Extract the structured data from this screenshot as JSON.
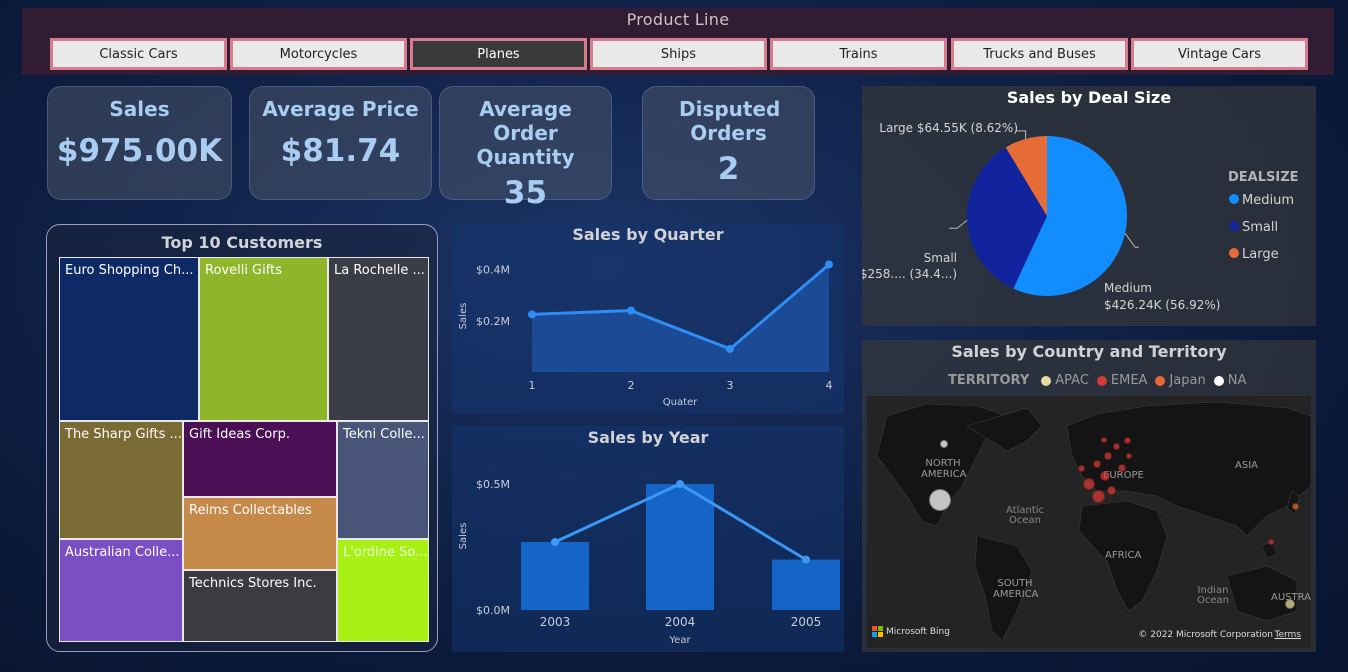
{
  "slicer": {
    "title": "Product Line",
    "items": [
      "Classic Cars",
      "Motorcycles",
      "Planes",
      "Ships",
      "Trains",
      "Trucks and Buses",
      "Vintage Cars"
    ],
    "selected": "Planes"
  },
  "kpis": {
    "sales": {
      "label": "Sales",
      "value": "$975.00K"
    },
    "avg_price": {
      "label": "Average Price",
      "value": "$81.74"
    },
    "avg_qty": {
      "label": "Average Order Quantity",
      "value": "35"
    },
    "disputed": {
      "label": "Disputed Orders",
      "value": "2"
    }
  },
  "top_customers": {
    "title": "Top 10 Customers",
    "items": [
      {
        "label": "Euro Shopping Ch...",
        "color": "#0e2a66"
      },
      {
        "label": "Rovelli Gifts",
        "color": "#8fb52a"
      },
      {
        "label": "La Rochelle ...",
        "color": "#3a3d46"
      },
      {
        "label": "The Sharp Gifts ...",
        "color": "#7a6a34"
      },
      {
        "label": "Gift Ideas Corp.",
        "color": "#4b0f55"
      },
      {
        "label": "Tekni Colle...",
        "color": "#485478"
      },
      {
        "label": "Reims Collectables",
        "color": "#c58a4a"
      },
      {
        "label": "Australian Colle...",
        "color": "#7c4ec4"
      },
      {
        "label": "Technics Stores Inc.",
        "color": "#3b3b40"
      },
      {
        "label": "L'ordine So...",
        "color": "#a8f016"
      }
    ]
  },
  "chart_data": [
    {
      "type": "area",
      "title": "Sales by Quarter",
      "xlabel": "Quater",
      "ylabel": "Sales",
      "categories": [
        "1",
        "2",
        "3",
        "4"
      ],
      "values": [
        0.225,
        0.24,
        0.09,
        0.42
      ],
      "y_tick_labels": [
        "$0.4M",
        "$0.2M"
      ],
      "ylim": [
        0,
        0.5
      ],
      "color": "#2f8df5"
    },
    {
      "type": "bar",
      "title": "Sales by Year",
      "xlabel": "Year",
      "ylabel": "Sales",
      "categories": [
        "2003",
        "2004",
        "2005"
      ],
      "values": [
        0.27,
        0.5,
        0.2
      ],
      "y_tick_labels": [
        "$0.5M",
        "$0.0M"
      ],
      "ylim": [
        0,
        0.5
      ],
      "bar_color": "#1565c8",
      "line_color": "#3c97f5"
    },
    {
      "type": "pie",
      "title": "Sales by Deal Size",
      "legend_title": "DEALSIZE",
      "slices": [
        {
          "name": "Medium",
          "value": 56.92,
          "label": "Medium",
          "label2": "$426.24K (56.92%)",
          "color": "#118dff"
        },
        {
          "name": "Small",
          "value": 34.46,
          "label": "Small",
          "label2": "$258.... (34.4...)",
          "color": "#12239e"
        },
        {
          "name": "Large",
          "value": 8.62,
          "label": "Large $64.55K (8.62%)",
          "label2": "",
          "color": "#e66c37"
        }
      ]
    }
  ],
  "map": {
    "title": "Sales by Country and Territory",
    "legend_title": "TERRITORY",
    "legend": [
      {
        "name": "APAC",
        "color": "#e8dba0"
      },
      {
        "name": "EMEA",
        "color": "#d63a36"
      },
      {
        "name": "Japan",
        "color": "#e66c37"
      },
      {
        "name": "NA",
        "color": "#ffffff"
      }
    ],
    "labels": {
      "north_america": "NORTH AMERICA",
      "europe": "EUROPE",
      "asia": "ASIA",
      "atlantic": "Atlantic Ocean",
      "africa": "AFRICA",
      "south_america": "SOUTH AMERICA",
      "indian": "Indian Ocean",
      "australia": "AUSTRA"
    },
    "brand": "Microsoft Bing",
    "copyright": "© 2022 Microsoft Corporation",
    "terms": "Terms"
  }
}
